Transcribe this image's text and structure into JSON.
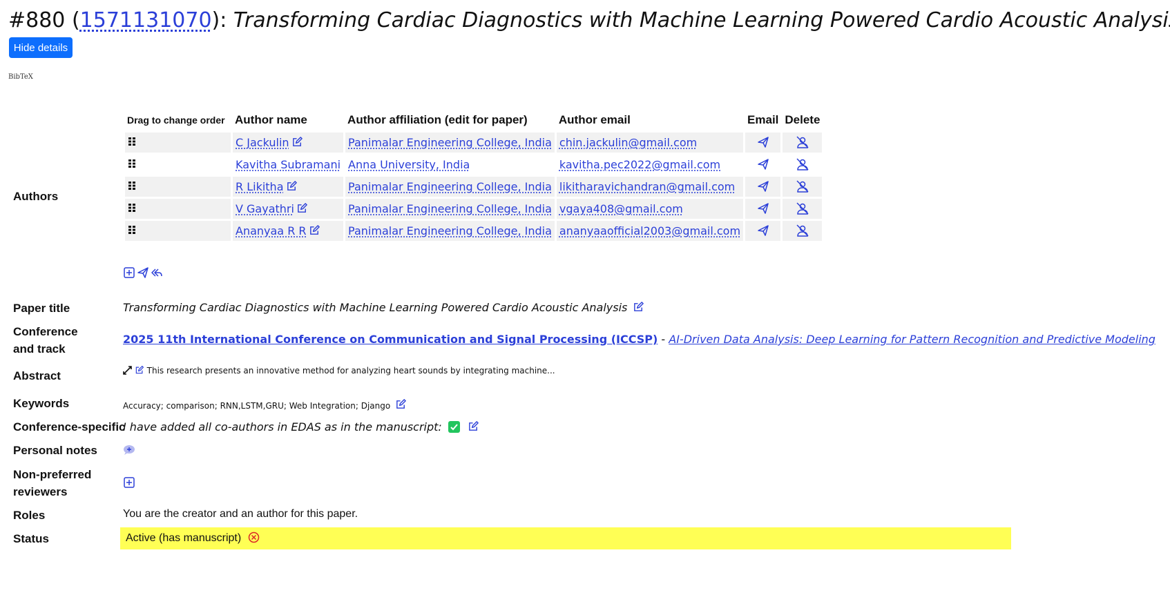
{
  "header": {
    "number": "#880",
    "open_paren": "(",
    "paper_id": "1571131070",
    "close_paren": "):",
    "paper_title": "Transforming Cardiac Diagnostics with Machine Learning Powered Cardio Acoustic Analysis"
  },
  "buttons": {
    "hide_details": "Hide details"
  },
  "bibtex": "BibTeX",
  "labels": {
    "authors": "Authors",
    "paper_title": "Paper title",
    "conference_line1": "Conference",
    "conference_line2": "and track",
    "abstract": "Abstract",
    "keywords": "Keywords",
    "conference_specific": "Conference-specific",
    "personal_notes": "Personal notes",
    "nonpref_line1": "Non-preferred",
    "nonpref_line2": "reviewers",
    "roles": "Roles",
    "status": "Status"
  },
  "authors_table": {
    "headers": {
      "drag": "Drag to change order",
      "name": "Author name",
      "affiliation": "Author affiliation (edit for paper)",
      "email": "Author email",
      "email_action": "Email",
      "delete_action": "Delete"
    },
    "rows": [
      {
        "name": "C Jackulin",
        "affiliation": "Panimalar Engineering College, India",
        "email": "chin.jackulin@gmail.com",
        "editable": true
      },
      {
        "name": "Kavitha Subramani",
        "affiliation": "Anna University, India",
        "email": "kavitha.pec2022@gmail.com",
        "editable": false
      },
      {
        "name": "R Likitha",
        "affiliation": "Panimalar Engineering College, India",
        "email": "likitharavichandran@gmail.com",
        "editable": true
      },
      {
        "name": "V Gayathri",
        "affiliation": "Panimalar Engineering College, India",
        "email": "vgaya408@gmail.com",
        "editable": true
      },
      {
        "name": "Ananyaa R R",
        "affiliation": "Panimalar Engineering College, India",
        "email": "ananyaaofficial2003@gmail.com",
        "editable": true
      }
    ]
  },
  "paper_title_value": "Transforming Cardiac Diagnostics with Machine Learning Powered Cardio Acoustic Analysis",
  "conference": {
    "name": "2025 11th International Conference on Communication and Signal Processing (ICCSP)",
    "separator": " - ",
    "track": "AI-Driven Data Analysis: Deep Learning for Pattern Recognition and Predictive Modeling"
  },
  "abstract_text": "This research presents an innovative method for analyzing heart sounds by integrating machine...",
  "keywords_text": "Accuracy; comparison; RNN,LSTM,GRU; Web Integration; Django",
  "conference_specific_text": "I have added all co-authors in EDAS as in the manuscript:",
  "roles_text": "You are the creator and an author for this paper.",
  "status_text": "Active (has manuscript)",
  "colors": {
    "link": "#2b3fd8",
    "primary_button": "#0d6efd",
    "status_highlight": "#ffff55",
    "check_green": "#22c55e",
    "cancel_red": "#dc2626"
  }
}
